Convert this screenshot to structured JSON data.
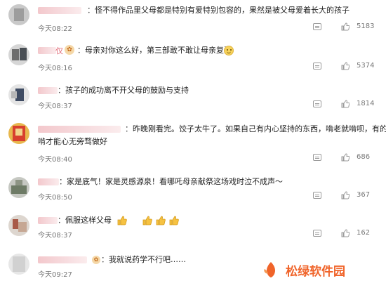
{
  "comments": [
    {
      "text": "怪不得作品里父母都是特别有爱特别包容的，果然是被父母爱着长大的孩子",
      "time": "今天08:22",
      "likes": "5183"
    },
    {
      "name_visible": "仅",
      "text": "母亲对你这么好，第三部敢不敢让母亲复活",
      "time": "今天08:16",
      "likes": "5374"
    },
    {
      "text": "孩子的成功离不开父母的鼓励与支持",
      "time": "今天08:37",
      "likes": "1814"
    },
    {
      "text_line1": "昨晚刚看完。饺子太牛了。如果自己有内心坚持的东西，啃老就啃呗，有的",
      "text_line2": "啃才能心无旁骛做好",
      "time": "今天08:40",
      "likes": "686"
    },
    {
      "text": "家是底气！家是灵感源泉！看哪吒母亲献祭这场戏时泣不成声～",
      "time": "今天08:50",
      "likes": "367"
    },
    {
      "text": "佩服这样父母",
      "time": "今天08:37",
      "likes": "162"
    },
    {
      "text": "我就说药学不行吧……",
      "time": "今天09:27",
      "likes": ""
    }
  ],
  "icons": {
    "comment": "comment-icon",
    "like": "thumbs-up-icon",
    "smile": "smile-emoji-icon",
    "thumb_emoji": "thumbs-up-emoji-icon"
  },
  "watermark": {
    "text": "松绿软件园",
    "color": "#f0642a"
  },
  "colors": {
    "background": "#ffffff",
    "username": "#e16d7a",
    "secondary": "#777777"
  }
}
